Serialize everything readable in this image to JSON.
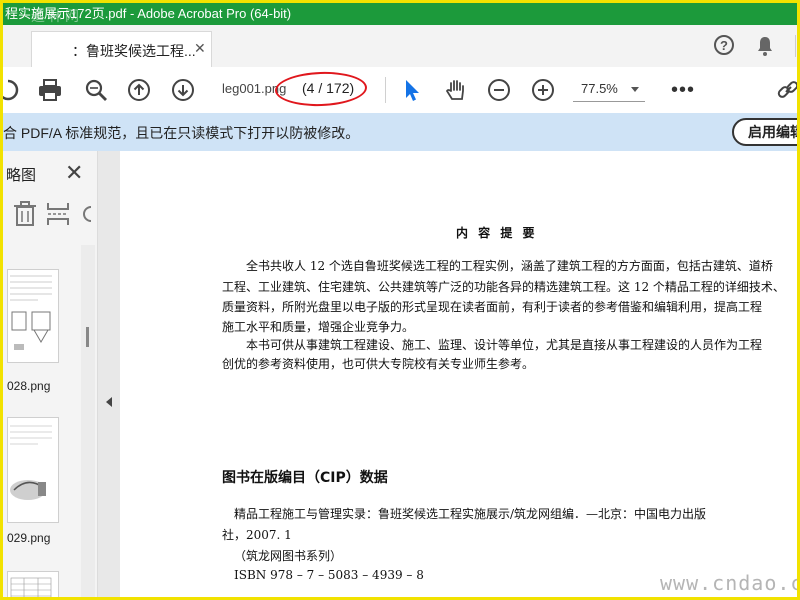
{
  "window": {
    "title": "程实施展示172页.pdf - Adobe Acrobat Pro (64-bit)",
    "title_watermark": "道林网"
  },
  "tab": {
    "label": "：鲁班奖候选工程...",
    "close": "✕"
  },
  "toolbar": {
    "filename": "leg001.png",
    "page_indicator": "(4 / 172)",
    "zoom": "77.5%",
    "more": "•••"
  },
  "banner": {
    "text": "合 PDF/A 标准规范，且已在只读模式下打开以防被修改。",
    "button": "启用编辑"
  },
  "left_panel": {
    "title": "略图",
    "thumbnails": [
      {
        "label": "028.png"
      },
      {
        "label": "029.png"
      }
    ]
  },
  "document": {
    "heading": "内 容 提 要",
    "para1_lines": [
      "全书共收人 12 个选自鲁班奖候选工程的工程实例，涵盖了建筑工程的方方面面，包括古建筑、道桥",
      "工程、工业建筑、住宅建筑、公共建筑等广泛的功能各异的精选建筑工程。这 12 个精品工程的详细技术、",
      "质量资料，所附光盘里以电子版的形式呈现在读者面前，有利于读者的参考借鉴和编辑利用，提高工程",
      "施工水平和质量，增强企业竞争力。"
    ],
    "para2_lines": [
      "本书可供从事建筑工程建设、施工、监理、设计等单位，尤其是直接从事工程建设的人员作为工程",
      "创优的参考资料使用，也可供大专院校有关专业师生参考。"
    ],
    "cip_heading": "图书在版编目（CIP）数据",
    "cip_lines": [
      "精品工程施工与管理实录：鲁班奖候选工程实施展示/筑龙网组编．—北京：中国电力出版",
      "社，2007. 1",
      "（筑龙网图书系列）",
      "ISBN 978 – 7 – 5083 – 4939 – 8"
    ],
    "watermark": "www.cndao.com"
  },
  "colors": {
    "titlebar": "#1c9a3b",
    "frame": "#f2e200",
    "banner": "#cfe3f6",
    "annotation": "#e0171d",
    "cursor_tool": "#1473e6"
  }
}
